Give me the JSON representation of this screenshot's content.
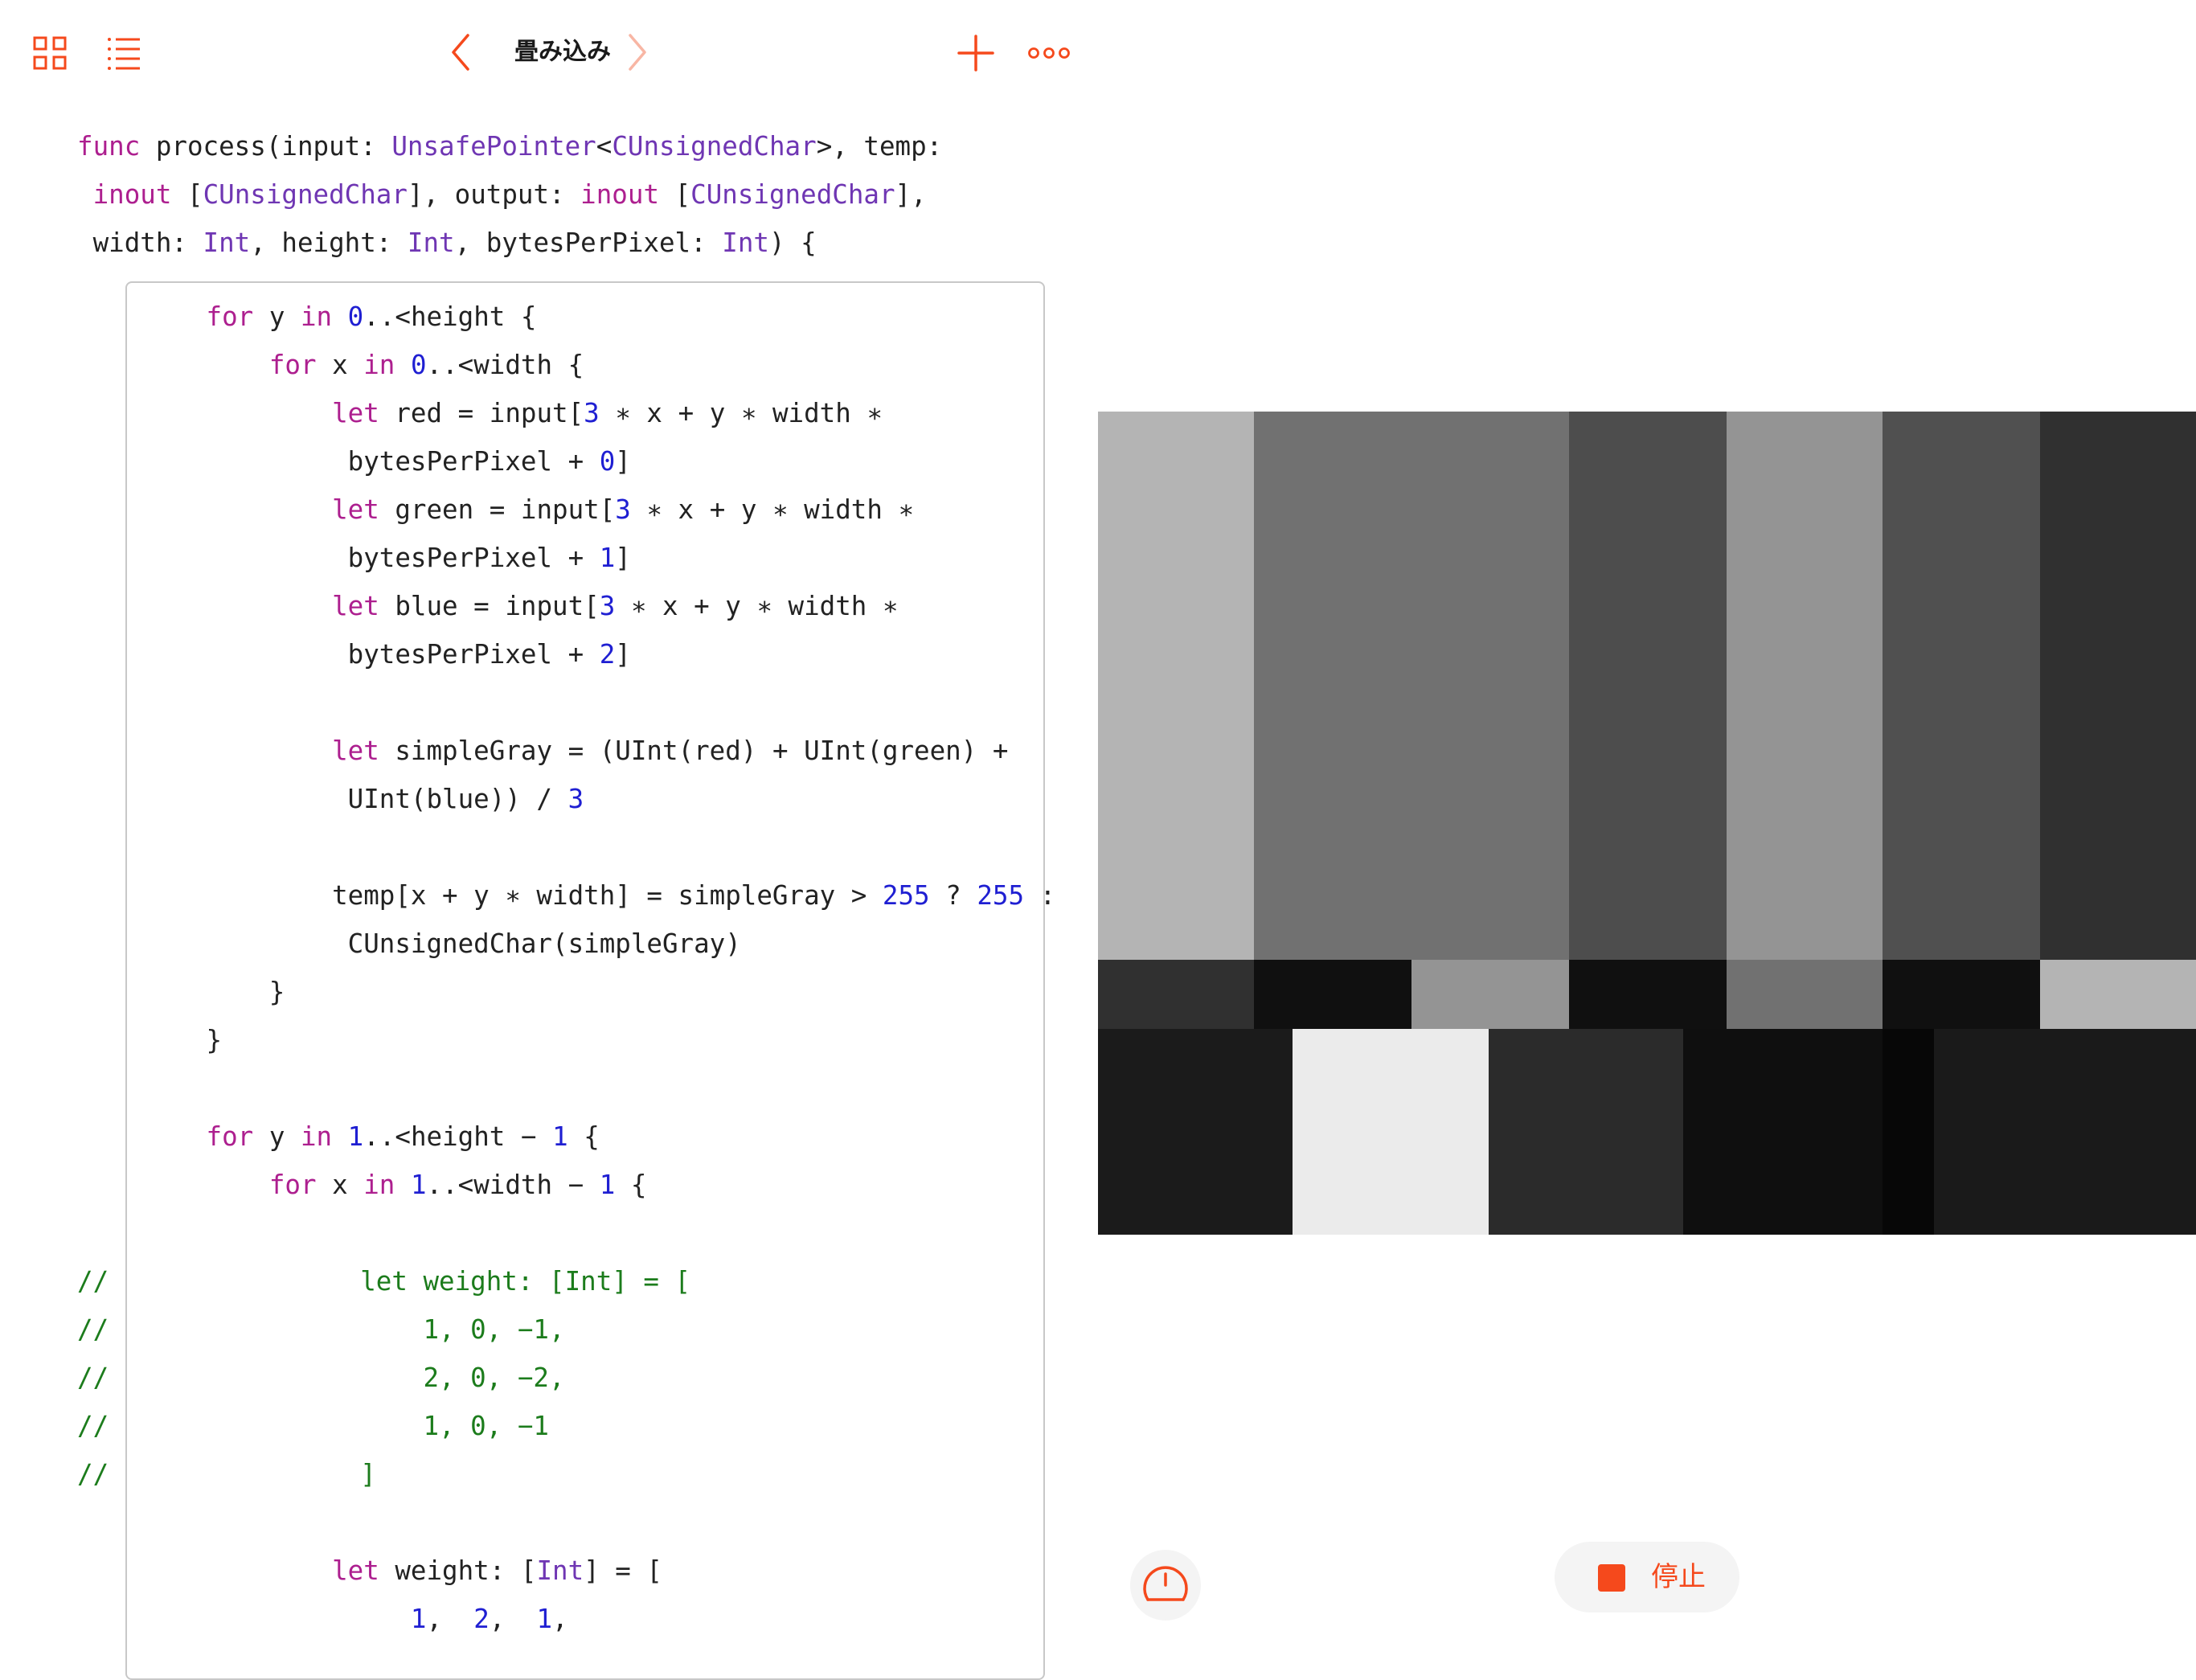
{
  "toolbar": {
    "title": "畳み込み",
    "accent": "#f5491c",
    "icons": [
      "grid-icon",
      "list-icon",
      "chevron-left-icon",
      "chevron-right-icon",
      "plus-icon",
      "more-icon"
    ]
  },
  "code": {
    "lines": [
      [
        [
          "kw",
          "func"
        ],
        [
          "p",
          " process(input: "
        ],
        [
          "ty",
          "UnsafePointer"
        ],
        [
          "p",
          "<"
        ],
        [
          "ty",
          "CUnsignedChar"
        ],
        [
          "p",
          ">, temp:"
        ]
      ],
      [
        [
          "p",
          " "
        ],
        [
          "kw",
          "inout"
        ],
        [
          "p",
          " ["
        ],
        [
          "ty",
          "CUnsignedChar"
        ],
        [
          "p",
          "], output: "
        ],
        [
          "kw",
          "inout"
        ],
        [
          "p",
          " ["
        ],
        [
          "ty",
          "CUnsignedChar"
        ],
        [
          "p",
          "],"
        ]
      ],
      [
        [
          "p",
          " width: "
        ],
        [
          "ty",
          "Int"
        ],
        [
          "p",
          ", height: "
        ],
        [
          "ty",
          "Int"
        ],
        [
          "p",
          ", bytesPerPixel: "
        ],
        [
          "ty",
          "Int"
        ],
        [
          "p",
          ") {"
        ]
      ],
      [
        [
          "p",
          "        "
        ],
        [
          "kw",
          "for"
        ],
        [
          "p",
          " y "
        ],
        [
          "kw",
          "in"
        ],
        [
          "p",
          " "
        ],
        [
          "num",
          "0"
        ],
        [
          "p",
          "..<height {"
        ]
      ],
      [
        [
          "p",
          "            "
        ],
        [
          "kw",
          "for"
        ],
        [
          "p",
          " x "
        ],
        [
          "kw",
          "in"
        ],
        [
          "p",
          " "
        ],
        [
          "num",
          "0"
        ],
        [
          "p",
          "..<width {"
        ]
      ],
      [
        [
          "p",
          "                "
        ],
        [
          "kw",
          "let"
        ],
        [
          "p",
          " red = input["
        ],
        [
          "num",
          "3"
        ],
        [
          "p",
          " ∗ x + y ∗ width ∗"
        ]
      ],
      [
        [
          "p",
          "                 bytesPerPixel + "
        ],
        [
          "num",
          "0"
        ],
        [
          "p",
          "]"
        ]
      ],
      [
        [
          "p",
          "                "
        ],
        [
          "kw",
          "let"
        ],
        [
          "p",
          " green = input["
        ],
        [
          "num",
          "3"
        ],
        [
          "p",
          " ∗ x + y ∗ width ∗"
        ]
      ],
      [
        [
          "p",
          "                 bytesPerPixel + "
        ],
        [
          "num",
          "1"
        ],
        [
          "p",
          "]"
        ]
      ],
      [
        [
          "p",
          "                "
        ],
        [
          "kw",
          "let"
        ],
        [
          "p",
          " blue = input["
        ],
        [
          "num",
          "3"
        ],
        [
          "p",
          " ∗ x + y ∗ width ∗"
        ]
      ],
      [
        [
          "p",
          "                 bytesPerPixel + "
        ],
        [
          "num",
          "2"
        ],
        [
          "p",
          "]"
        ]
      ],
      [
        [
          "p",
          ""
        ]
      ],
      [
        [
          "p",
          "                "
        ],
        [
          "kw",
          "let"
        ],
        [
          "p",
          " simpleGray = (UInt(red) + UInt(green) +"
        ]
      ],
      [
        [
          "p",
          "                 UInt(blue)) / "
        ],
        [
          "num",
          "3"
        ]
      ],
      [
        [
          "p",
          ""
        ]
      ],
      [
        [
          "p",
          "                temp[x + y ∗ width] = simpleGray > "
        ],
        [
          "num",
          "255"
        ],
        [
          "p",
          " ? "
        ],
        [
          "num",
          "255"
        ],
        [
          "p",
          " :"
        ]
      ],
      [
        [
          "p",
          "                 CUnsignedChar(simpleGray)"
        ]
      ],
      [
        [
          "p",
          "            }"
        ]
      ],
      [
        [
          "p",
          "        }"
        ]
      ],
      [
        [
          "p",
          ""
        ]
      ],
      [
        [
          "p",
          "        "
        ],
        [
          "kw",
          "for"
        ],
        [
          "p",
          " y "
        ],
        [
          "kw",
          "in"
        ],
        [
          "p",
          " "
        ],
        [
          "num",
          "1"
        ],
        [
          "p",
          "..<height − "
        ],
        [
          "num",
          "1"
        ],
        [
          "p",
          " {"
        ]
      ],
      [
        [
          "p",
          "            "
        ],
        [
          "kw",
          "for"
        ],
        [
          "p",
          " x "
        ],
        [
          "kw",
          "in"
        ],
        [
          "p",
          " "
        ],
        [
          "num",
          "1"
        ],
        [
          "p",
          "..<width − "
        ],
        [
          "num",
          "1"
        ],
        [
          "p",
          " {"
        ]
      ],
      [
        [
          "p",
          ""
        ]
      ],
      [
        [
          "cm",
          "//                let weight: [Int] = ["
        ]
      ],
      [
        [
          "cm",
          "//                    1, 0, −1,"
        ]
      ],
      [
        [
          "cm",
          "//                    2, 0, −2,"
        ]
      ],
      [
        [
          "cm",
          "//                    1, 0, −1"
        ]
      ],
      [
        [
          "cm",
          "//                ]"
        ]
      ],
      [
        [
          "p",
          ""
        ]
      ],
      [
        [
          "p",
          "                "
        ],
        [
          "kw",
          "let"
        ],
        [
          "p",
          " weight: ["
        ],
        [
          "ty",
          "Int"
        ],
        [
          "p",
          "] = ["
        ]
      ],
      [
        [
          "p",
          "                     "
        ],
        [
          "num",
          "1"
        ],
        [
          "p",
          ",  "
        ],
        [
          "num",
          "2"
        ],
        [
          "p",
          ",  "
        ],
        [
          "num",
          "1"
        ],
        [
          "p",
          ","
        ]
      ]
    ]
  },
  "preview": {
    "colors": [
      [
        "#b4b4b4",
        "#717171",
        "#717171",
        "#4d4d4d",
        "#949494",
        "#505050",
        "#303030"
      ],
      [
        "#b4b4b4",
        "#717171",
        "#717171",
        "#4d4d4d",
        "#949494",
        "#505050",
        "#303030"
      ],
      [
        "#b4b4b4",
        "#717171",
        "#717171",
        "#4d4d4d",
        "#949494",
        "#505050",
        "#303030"
      ],
      [
        "#b4b4b4",
        "#717171",
        "#717171",
        "#4d4d4d",
        "#949494",
        "#505050",
        "#303030"
      ],
      [
        "#b4b4b4",
        "#717171",
        "#717171",
        "#4d4d4d",
        "#949494",
        "#505050",
        "#303030"
      ],
      [
        "#b4b4b4",
        "#717171",
        "#717171",
        "#4d4d4d",
        "#949494",
        "#505050",
        "#303030"
      ],
      [
        "#b4b4b4",
        "#717171",
        "#717171",
        "#4d4d4d",
        "#949494",
        "#505050",
        "#303030"
      ],
      [
        "#b4b4b4",
        "#717171",
        "#717171",
        "#4d4d4d",
        "#949494",
        "#505050",
        "#303030"
      ],
      [
        "#303030",
        "#101010",
        "#949494",
        "#101010",
        "#717171",
        "#101010",
        "#b4b4b4"
      ],
      [
        "#1b1b1b",
        "#ebebeb",
        "#2b2b2b",
        "#0f0f0f",
        "#070707",
        "#1a1a1a"
      ],
      [
        "#1b1b1b",
        "#ebebeb",
        "#2b2b2b",
        "#0f0f0f",
        "#070707",
        "#1a1a1a"
      ],
      [
        "#1b1b1b",
        "#ebebeb",
        "#2b2b2b",
        "#0f0f0f",
        "#070707",
        "#1a1a1a"
      ]
    ]
  },
  "controls": {
    "stop_label": "停止"
  }
}
